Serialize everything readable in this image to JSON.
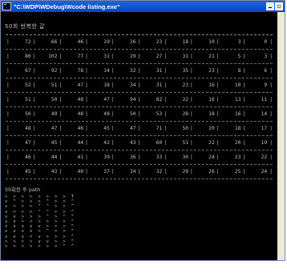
{
  "window": {
    "title": "\"C:\\WDP\\WDebug\\Wcode listing.exe\""
  },
  "console": {
    "heading_values": "50회 반복한 값",
    "heading_path": "50회전 후 path",
    "rows": [
      [
        "72",
        "66",
        "46",
        "29",
        "26",
        "23",
        "18",
        "10",
        "3",
        "0"
      ],
      [
        "80",
        "102",
        "77",
        "31",
        "29",
        "27",
        "31",
        "21",
        "5",
        "3"
      ],
      [
        "67",
        "92",
        "78",
        "34",
        "32",
        "31",
        "35",
        "23",
        "8",
        "6"
      ],
      [
        "52",
        "51",
        "47",
        "38",
        "34",
        "31",
        "23",
        "16",
        "10",
        "9"
      ],
      [
        "51",
        "50",
        "48",
        "47",
        "94",
        "82",
        "22",
        "16",
        "13",
        "11"
      ],
      [
        "50",
        "49",
        "48",
        "48",
        "50",
        "53",
        "28",
        "18",
        "16",
        "14"
      ],
      [
        "48",
        "47",
        "46",
        "45",
        "47",
        "71",
        "50",
        "20",
        "18",
        "17"
      ],
      [
        "47",
        "45",
        "44",
        "42",
        "43",
        "60",
        "51",
        "22",
        "20",
        "19"
      ],
      [
        "46",
        "44",
        "41",
        "39",
        "36",
        "33",
        "30",
        "24",
        "23",
        "22"
      ],
      [
        "45",
        "43",
        "40",
        "37",
        "34",
        "32",
        "29",
        "26",
        "25",
        "24"
      ]
    ],
    "path_lines": [
      "> > > > > > > > T",
      "v ^ > > > ^ > > ^",
      "v > > > ^ ^ > > ^",
      "v > > > ^ ^ > > ^",
      "v v > > > ^ > ^ ^",
      "v v > < < > > > ^",
      "v v v v v > > > ^",
      "v v v v < ^ > > ^",
      "v v v < v > > > ^",
      "> > > > v v > > ^",
      "> > > > > > > ^ ^"
    ]
  }
}
